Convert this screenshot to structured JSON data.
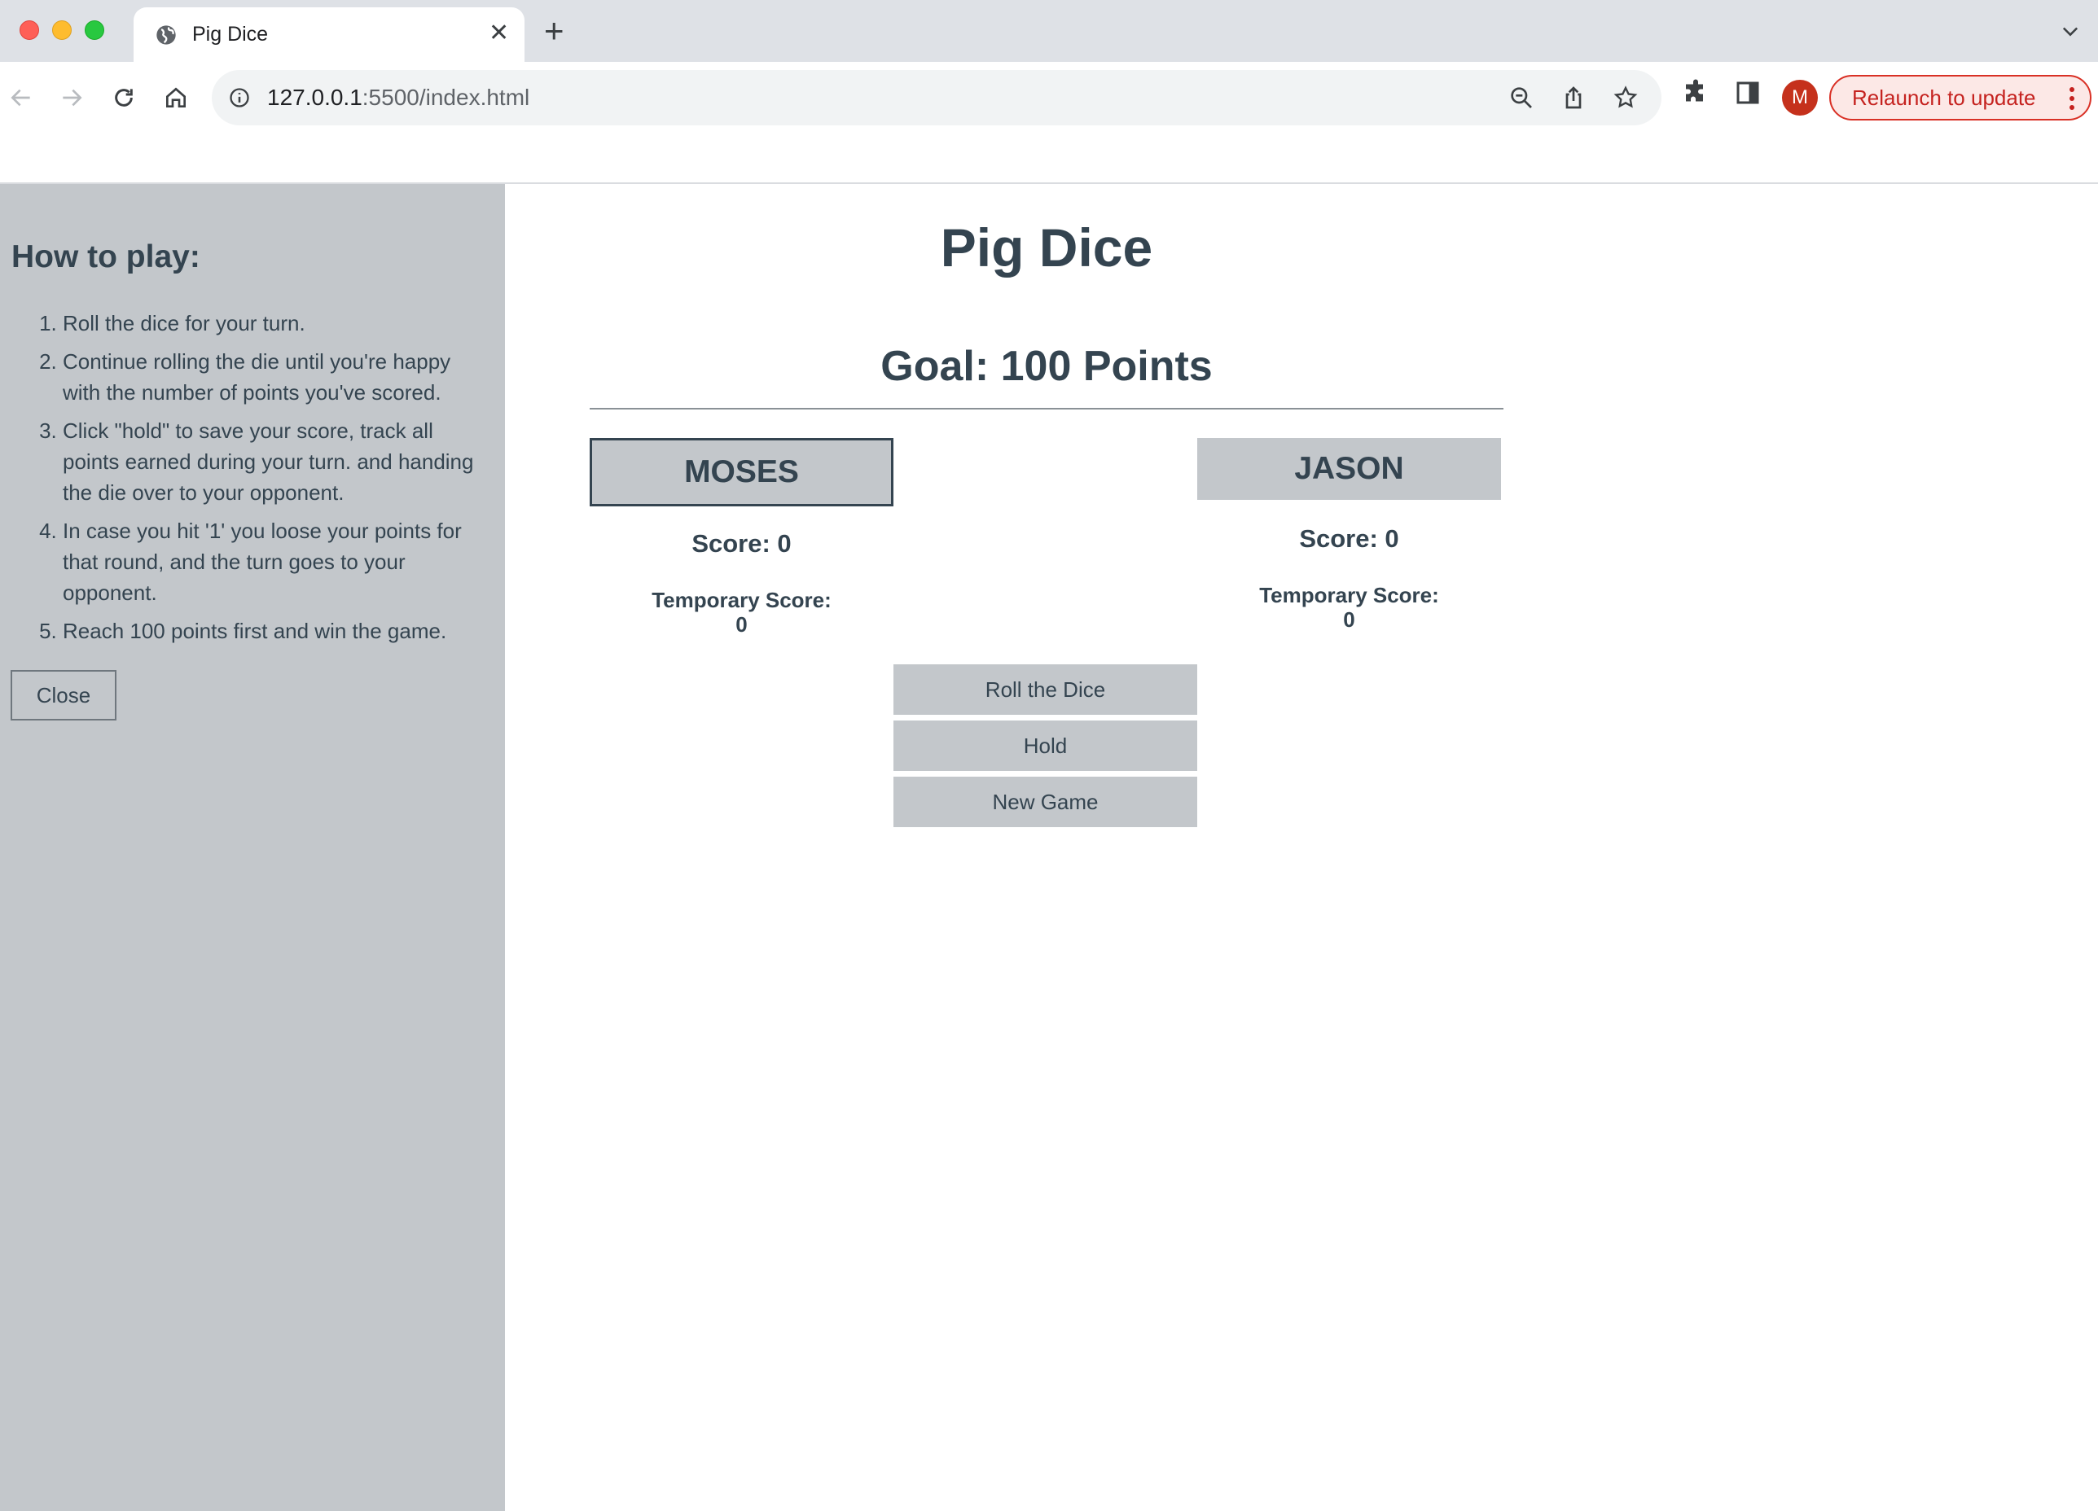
{
  "browser": {
    "tab_title": "Pig Dice",
    "url_host": "127.0.0.1",
    "url_rest": ":5500/index.html",
    "avatar_initial": "M",
    "relaunch_label": "Relaunch to update",
    "accent_color": "#c5221f"
  },
  "sidebar": {
    "title": "How to play:",
    "rules": [
      "Roll the dice for your turn.",
      "Continue rolling the die until you're happy with the number of points you've scored.",
      "Click \"hold\" to save your score, track all points earned during your turn. and handing the die over to your opponent.",
      "In case you hit '1' you loose your points for that round, and the turn goes to your opponent.",
      "Reach 100 points first and win the game."
    ],
    "close_label": "Close"
  },
  "game": {
    "title": "Pig Dice",
    "goal": "Goal: 100 Points",
    "players": [
      {
        "name": "MOSES",
        "score": "Score: 0",
        "temp_label": "Temporary Score:",
        "temp_value": "0",
        "active": true
      },
      {
        "name": "JASON",
        "score": "Score: 0",
        "temp_label": "Temporary Score:",
        "temp_value": "0",
        "active": false
      }
    ],
    "buttons": {
      "roll": "Roll the Dice",
      "hold": "Hold",
      "new_game": "New Game"
    }
  }
}
